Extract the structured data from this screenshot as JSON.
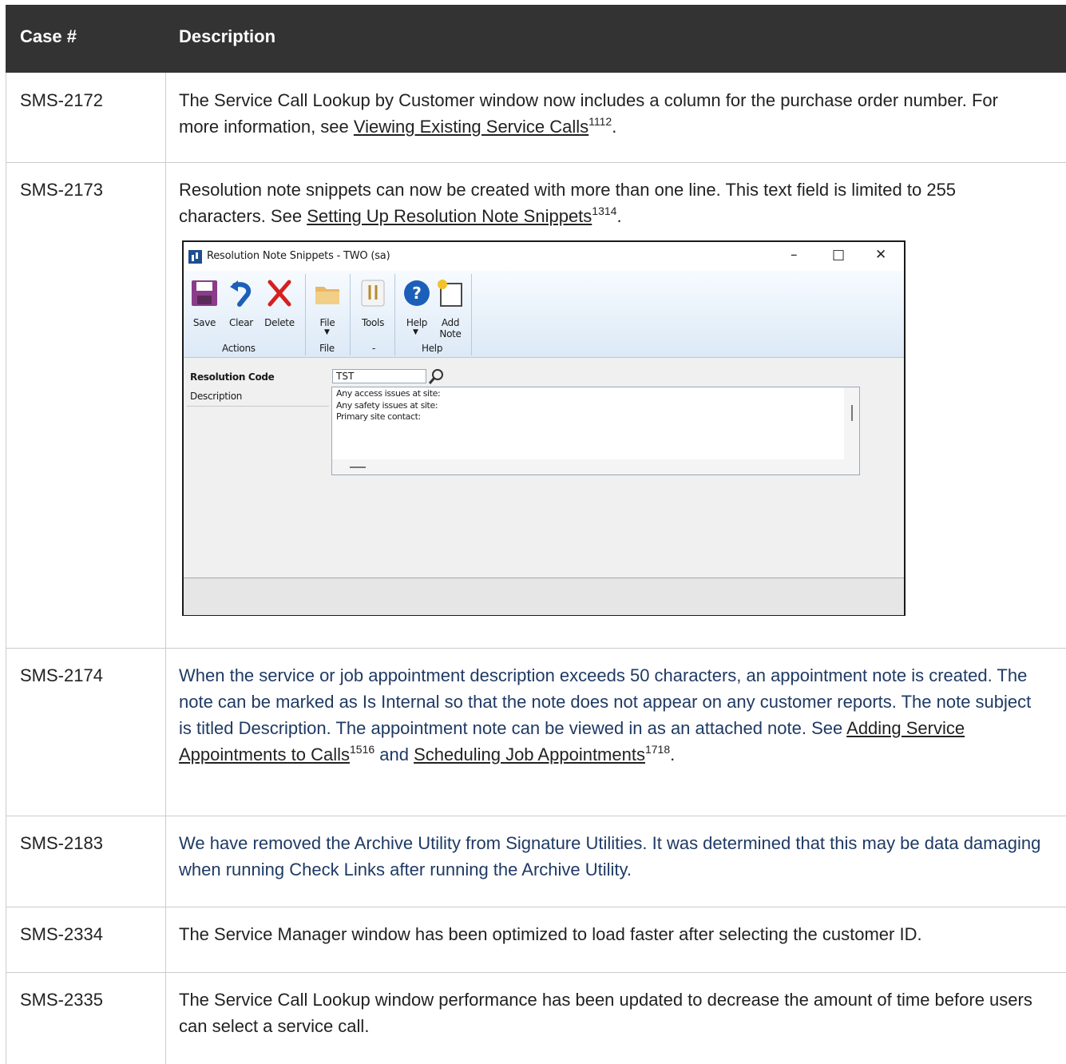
{
  "table": {
    "headers": {
      "case": "Case #",
      "description": "Description"
    },
    "rows": [
      {
        "case": "SMS-2172",
        "text1": "The Service Call Lookup by Customer window now includes a column for the purchase order number. For more information, see ",
        "link1": "Viewing Existing Service Calls",
        "sup1": "1112",
        "text2": "."
      },
      {
        "case": "SMS-2173",
        "text1": "Resolution note snippets can now be created with more than one line. This text field is limited to 255 characters. See ",
        "link1": "Setting Up Resolution Note Snippets",
        "sup1": "1314",
        "text2": "."
      },
      {
        "case": "SMS-2174",
        "text1": "When the service or job appointment description exceeds 50 characters, an appointment note is created. The note can be marked as Is Internal so that the note does not appear on any customer reports. The note subject is titled Description. The appointment note can be viewed in as an attached note. See ",
        "link1": "Adding Service Appointments to Calls",
        "sup1": "1516",
        "mid": " and ",
        "link2": "Scheduling Job Appointments",
        "sup2": "1718",
        "text2": "."
      },
      {
        "case": "SMS-2183",
        "text1": "We have removed the Archive Utility from Signature Utilities. It was determined that this may be data damaging when running Check Links after running the Archive Utility."
      },
      {
        "case": "SMS-2334",
        "text1": "The Service Manager window has been optimized to load faster after selecting the customer ID."
      },
      {
        "case": "SMS-2335",
        "text1": "The Service Call Lookup window performance has been updated to decrease the amount of time before users can select a service call."
      }
    ]
  },
  "screenshot": {
    "title": "Resolution Note Snippets  -  TWO (sa)",
    "ribbon": {
      "save": "Save",
      "clear": "Clear",
      "delete": "Delete",
      "file": "File",
      "tools": "Tools",
      "help": "Help",
      "add_note_1": "Add",
      "add_note_2": "Note",
      "groups": {
        "actions": "Actions",
        "file": "File",
        "tools": "-",
        "help": "Help"
      }
    },
    "form": {
      "resolution_code_label": "Resolution Code",
      "resolution_code_value": "TST",
      "description_label": "Description",
      "description_lines": [
        "Any access issues at site:",
        "Any safety issues at site:",
        "Primary site contact:"
      ]
    },
    "icons": [
      "app-icon",
      "minimize-icon",
      "maximize-icon",
      "close-icon",
      "save-icon",
      "clear-icon",
      "delete-icon",
      "file-icon",
      "tools-icon",
      "help-icon",
      "add-note-icon",
      "lookup-icon"
    ],
    "colors": {
      "save": "#8a3c8a",
      "clear": "#1c5fb8",
      "delete": "#d6201f",
      "help": "#1c5fb8",
      "folder": "#e8b866"
    }
  },
  "colors": {
    "header_bg": "#333333",
    "body_text": "#222222",
    "blue_text": "#1f3a64",
    "grid": "#cccccc"
  }
}
